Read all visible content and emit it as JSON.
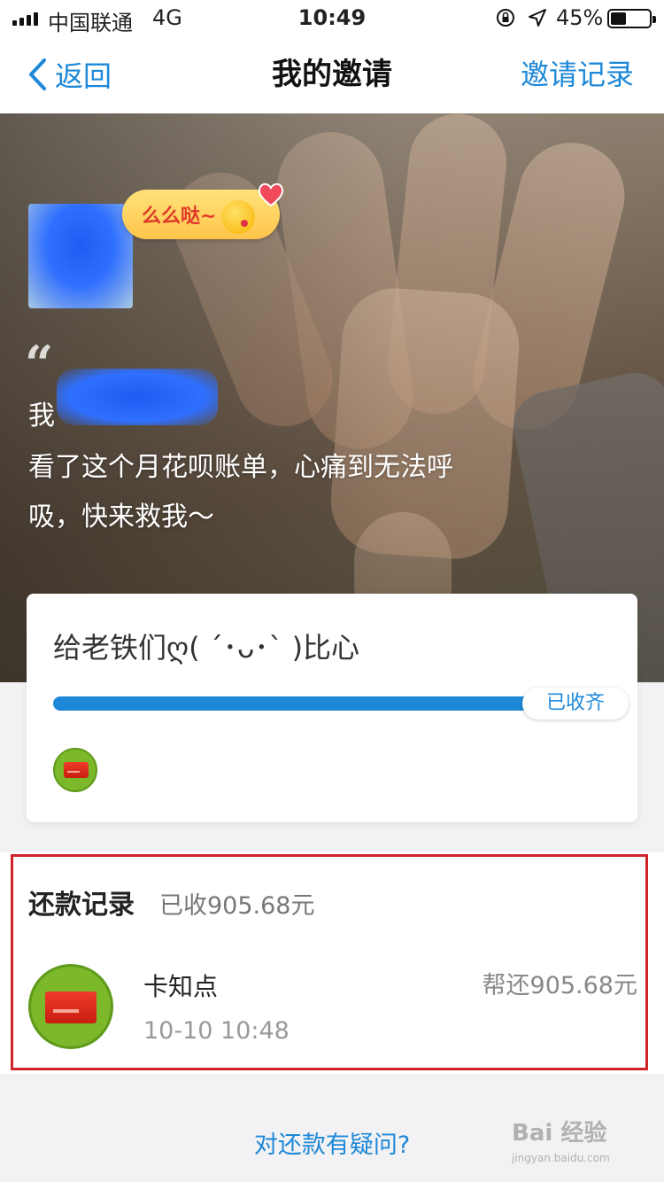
{
  "status_bar": {
    "carrier": "中国联通",
    "network": "4G",
    "time": "10:49",
    "battery_percent": "45%",
    "battery_level": 0.45
  },
  "nav": {
    "back_label": "返回",
    "title": "我的邀请",
    "right_label": "邀请记录"
  },
  "hero": {
    "bubble_text": "么么哒~",
    "quote_mark": "“",
    "name_prefix": "我",
    "quote_text": "看了这个月花呗账单，心痛到无法呼吸，快来救我～"
  },
  "progress_card": {
    "title": "给老铁们ღ( ´･ᴗ･` )比心",
    "progress": 1.0,
    "badge": "已收齐"
  },
  "records": {
    "title": "还款记录",
    "total": "已收905.68元",
    "items": [
      {
        "name": "卡知点",
        "time": "10-10 10:48",
        "amount": "帮还905.68元"
      }
    ]
  },
  "footer": {
    "question_link": "对还款有疑问?"
  },
  "watermark": {
    "text": "Bai 经验",
    "sub": "jingyan.baidu.com"
  }
}
